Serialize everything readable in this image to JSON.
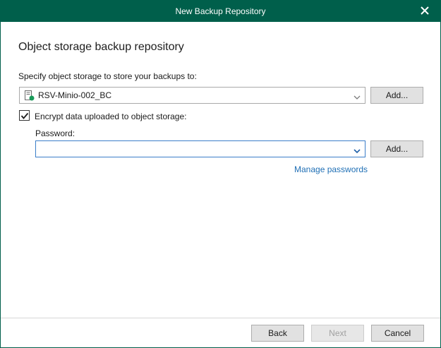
{
  "window": {
    "title": "New Backup Repository",
    "close_icon": "close-icon"
  },
  "page": {
    "heading": "Object storage backup repository"
  },
  "storage": {
    "label": "Specify object storage to store your backups to:",
    "selected": "RSV-Minio-002_BC",
    "icon": "object-storage-icon",
    "add_label": "Add..."
  },
  "encryption": {
    "checked": true,
    "label": "Encrypt data uploaded to object storage:",
    "password_label": "Password:",
    "password_value": "",
    "add_label": "Add...",
    "manage_link": "Manage passwords"
  },
  "footer": {
    "back_label": "Back",
    "next_label": "Next",
    "cancel_label": "Cancel"
  },
  "colors": {
    "titlebar": "#005f4b",
    "link": "#1f6fb5",
    "accent_icon": "#1a9b5a"
  }
}
